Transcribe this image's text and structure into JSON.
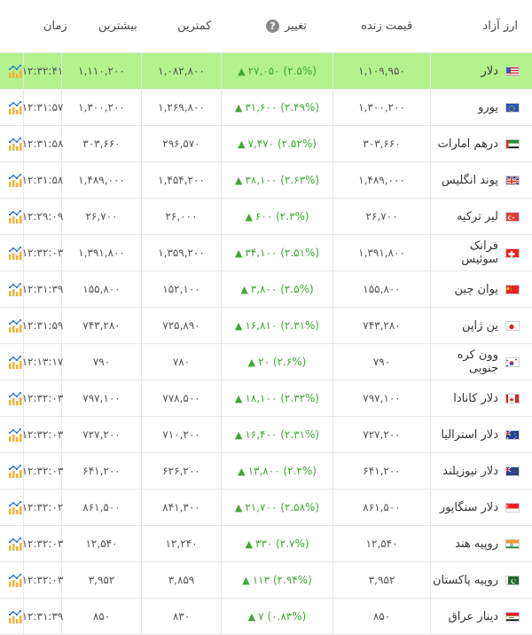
{
  "header": {
    "currency": "ارز آزاد",
    "live_price": "قیمت زنده",
    "change": "تغییر",
    "min": "کمترین",
    "max": "بیشترین",
    "time": "زمان"
  },
  "rows": [
    {
      "name": "دلار",
      "flag": "us",
      "price": "۱,۱۰۹,۹۵۰",
      "change": "۲۷,۰۵۰ (۲.۵%)",
      "min": "۱,۰۸۲,۸۰۰",
      "max": "۱,۱۱۰,۲۰۰",
      "time": "۱۲:۳۲:۴۱"
    },
    {
      "name": "یورو",
      "flag": "eu",
      "price": "۱,۳۰۰,۲۰۰",
      "change": "۳۱,۶۰۰ (۲.۴۹%)",
      "min": "۱,۲۶۹,۸۰۰",
      "max": "۱,۳۰۰,۲۰۰",
      "time": "۱۲:۳۱:۵۷"
    },
    {
      "name": "درهم امارات",
      "flag": "ae",
      "price": "۳۰۳,۶۶۰",
      "change": "۷,۴۷۰ (۲.۵۲%)",
      "min": "۲۹۶,۵۷۰",
      "max": "۳۰۳,۶۶۰",
      "time": "۱۲:۳۱:۵۸"
    },
    {
      "name": "پوند انگلیس",
      "flag": "gb",
      "price": "۱,۴۸۹,۰۰۰",
      "change": "۳۸,۱۰۰ (۲.۶۳%)",
      "min": "۱,۴۵۴,۲۰۰",
      "max": "۱,۴۸۹,۰۰۰",
      "time": "۱۲:۳۱:۵۸"
    },
    {
      "name": "لیر ترکیه",
      "flag": "tr",
      "price": "۲۶,۷۰۰",
      "change": "۶۰۰ (۲.۳%)",
      "min": "۲۶,۰۰۰",
      "max": "۲۶,۷۰۰",
      "time": "۱۲:۲۹:۰۹"
    },
    {
      "name": "فرانک سوئیس",
      "flag": "ch",
      "price": "۱,۳۹۱,۸۰۰",
      "change": "۳۴,۱۰۰ (۲.۵۱%)",
      "min": "۱,۳۵۹,۲۰۰",
      "max": "۱,۳۹۱,۸۰۰",
      "time": "۱۲:۳۲:۰۳"
    },
    {
      "name": "یوان چین",
      "flag": "cn",
      "price": "۱۵۵,۸۰۰",
      "change": "۳,۸۰۰ (۲.۵%)",
      "min": "۱۵۲,۱۰۰",
      "max": "۱۵۵,۸۰۰",
      "time": "۱۲:۳۱:۳۹"
    },
    {
      "name": "ین ژاپن",
      "flag": "jp",
      "price": "۷۴۳,۲۸۰",
      "change": "۱۶,۸۱۰ (۲.۳۱%)",
      "min": "۷۲۵,۸۹۰",
      "max": "۷۴۳,۲۸۰",
      "time": "۱۲:۳۱:۵۹"
    },
    {
      "name": "وون کره جنوبی",
      "flag": "kr",
      "price": "۷۹۰",
      "change": "۲۰ (۲.۶%)",
      "min": "۷۸۰",
      "max": "۷۹۰",
      "time": "۱۲:۱۳:۱۷"
    },
    {
      "name": "دلار کانادا",
      "flag": "ca",
      "price": "۷۹۷,۱۰۰",
      "change": "۱۸,۱۰۰ (۲.۳۲%)",
      "min": "۷۷۸,۵۰۰",
      "max": "۷۹۷,۱۰۰",
      "time": "۱۲:۳۲:۰۳"
    },
    {
      "name": "دلار استرالیا",
      "flag": "au",
      "price": "۷۲۷,۲۰۰",
      "change": "۱۶,۴۰۰ (۲.۳۱%)",
      "min": "۷۱۰,۲۰۰",
      "max": "۷۲۷,۲۰۰",
      "time": "۱۲:۳۲:۰۳"
    },
    {
      "name": "دلار نیوزیلند",
      "flag": "nz",
      "price": "۶۴۱,۲۰۰",
      "change": "۱۳,۸۰۰ (۲.۲%)",
      "min": "۶۲۶,۲۰۰",
      "max": "۶۴۱,۲۰۰",
      "time": "۱۲:۳۲:۰۳"
    },
    {
      "name": "دلار سنگاپور",
      "flag": "sg",
      "price": "۸۶۱,۵۰۰",
      "change": "۲۱,۷۰۰ (۲.۵۸%)",
      "min": "۸۴۱,۳۰۰",
      "max": "۸۶۱,۵۰۰",
      "time": "۱۲:۳۲:۰۲"
    },
    {
      "name": "روپیه هند",
      "flag": "in",
      "price": "۱۲,۵۴۰",
      "change": "۳۳۰ (۲.۷%)",
      "min": "۱۲,۲۴۰",
      "max": "۱۲,۵۴۰",
      "time": "۱۲:۳۲:۰۳"
    },
    {
      "name": "روپیه پاکستان",
      "flag": "pk",
      "price": "۳,۹۵۲",
      "change": "۱۱۳ (۲.۹۴%)",
      "min": "۳,۸۵۹",
      "max": "۳,۹۵۲",
      "time": "۱۲:۳۲:۰۳"
    },
    {
      "name": "دینار عراق",
      "flag": "iq",
      "price": "۸۵۰",
      "change": "۷ (۰.۸۳%)",
      "min": "۸۳۰",
      "max": "۸۵۰",
      "time": "۱۲:۳۱:۳۹"
    }
  ]
}
